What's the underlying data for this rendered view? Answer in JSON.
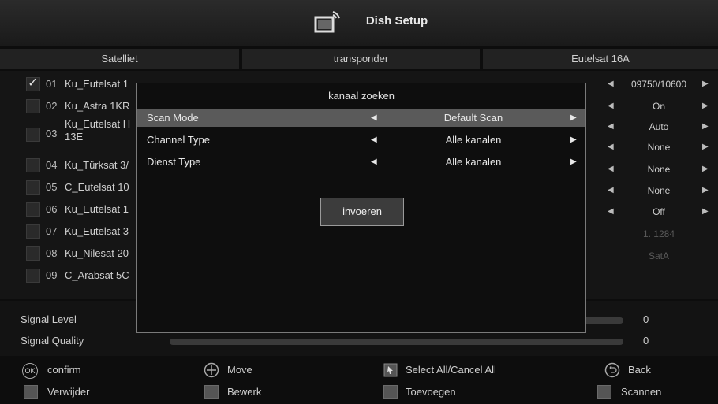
{
  "header": {
    "title": "Dish Setup"
  },
  "columns": {
    "satellite": "Satelliet",
    "transponder": "transponder",
    "current_sat": "Eutelsat 16A"
  },
  "satellites": [
    {
      "num": "01",
      "name": "Ku_Eutelsat 1",
      "checked": true
    },
    {
      "num": "02",
      "name": "Ku_Astra 1KR",
      "checked": false
    },
    {
      "num": "03",
      "name": "Ku_Eutelsat H",
      "name2": "13E",
      "checked": false
    },
    {
      "num": "04",
      "name": "Ku_Türksat 3/",
      "checked": false
    },
    {
      "num": "05",
      "name": "C_Eutelsat 10",
      "checked": false
    },
    {
      "num": "06",
      "name": "Ku_Eutelsat 1",
      "checked": false
    },
    {
      "num": "07",
      "name": "Ku_Eutelsat 3",
      "checked": false
    },
    {
      "num": "08",
      "name": "Ku_Nilesat 20",
      "checked": false
    },
    {
      "num": "09",
      "name": "C_Arabsat 5C",
      "checked": false
    }
  ],
  "settings": [
    {
      "value": "09750/10600",
      "arrows": true
    },
    {
      "value": "On",
      "arrows": true
    },
    {
      "value": "Auto",
      "arrows": true
    },
    {
      "value": "None",
      "arrows": true
    },
    {
      "value": "None",
      "arrows": true
    },
    {
      "value": "None",
      "arrows": true
    },
    {
      "value": "Off",
      "arrows": true
    },
    {
      "value": "1. 1284",
      "arrows": false
    },
    {
      "value": "SatA",
      "arrows": false
    }
  ],
  "signal": {
    "level_label": "Signal Level",
    "quality_label": "Signal Quality",
    "level_value": "0",
    "quality_value": "0"
  },
  "dialog": {
    "title": "kanaal zoeken",
    "rows": [
      {
        "label": "Scan Mode",
        "value": "Default Scan"
      },
      {
        "label": "Channel Type",
        "value": "Alle kanalen"
      },
      {
        "label": "Dienst Type",
        "value": "Alle kanalen"
      }
    ],
    "button": "invoeren"
  },
  "footer": {
    "confirm": "confirm",
    "ok_icon": "OK",
    "move": "Move",
    "select_all": "Select All/Cancel All",
    "back": "Back",
    "delete": "Verwijder",
    "edit": "Bewerk",
    "add": "Toevoegen",
    "scan": "Scannen"
  }
}
